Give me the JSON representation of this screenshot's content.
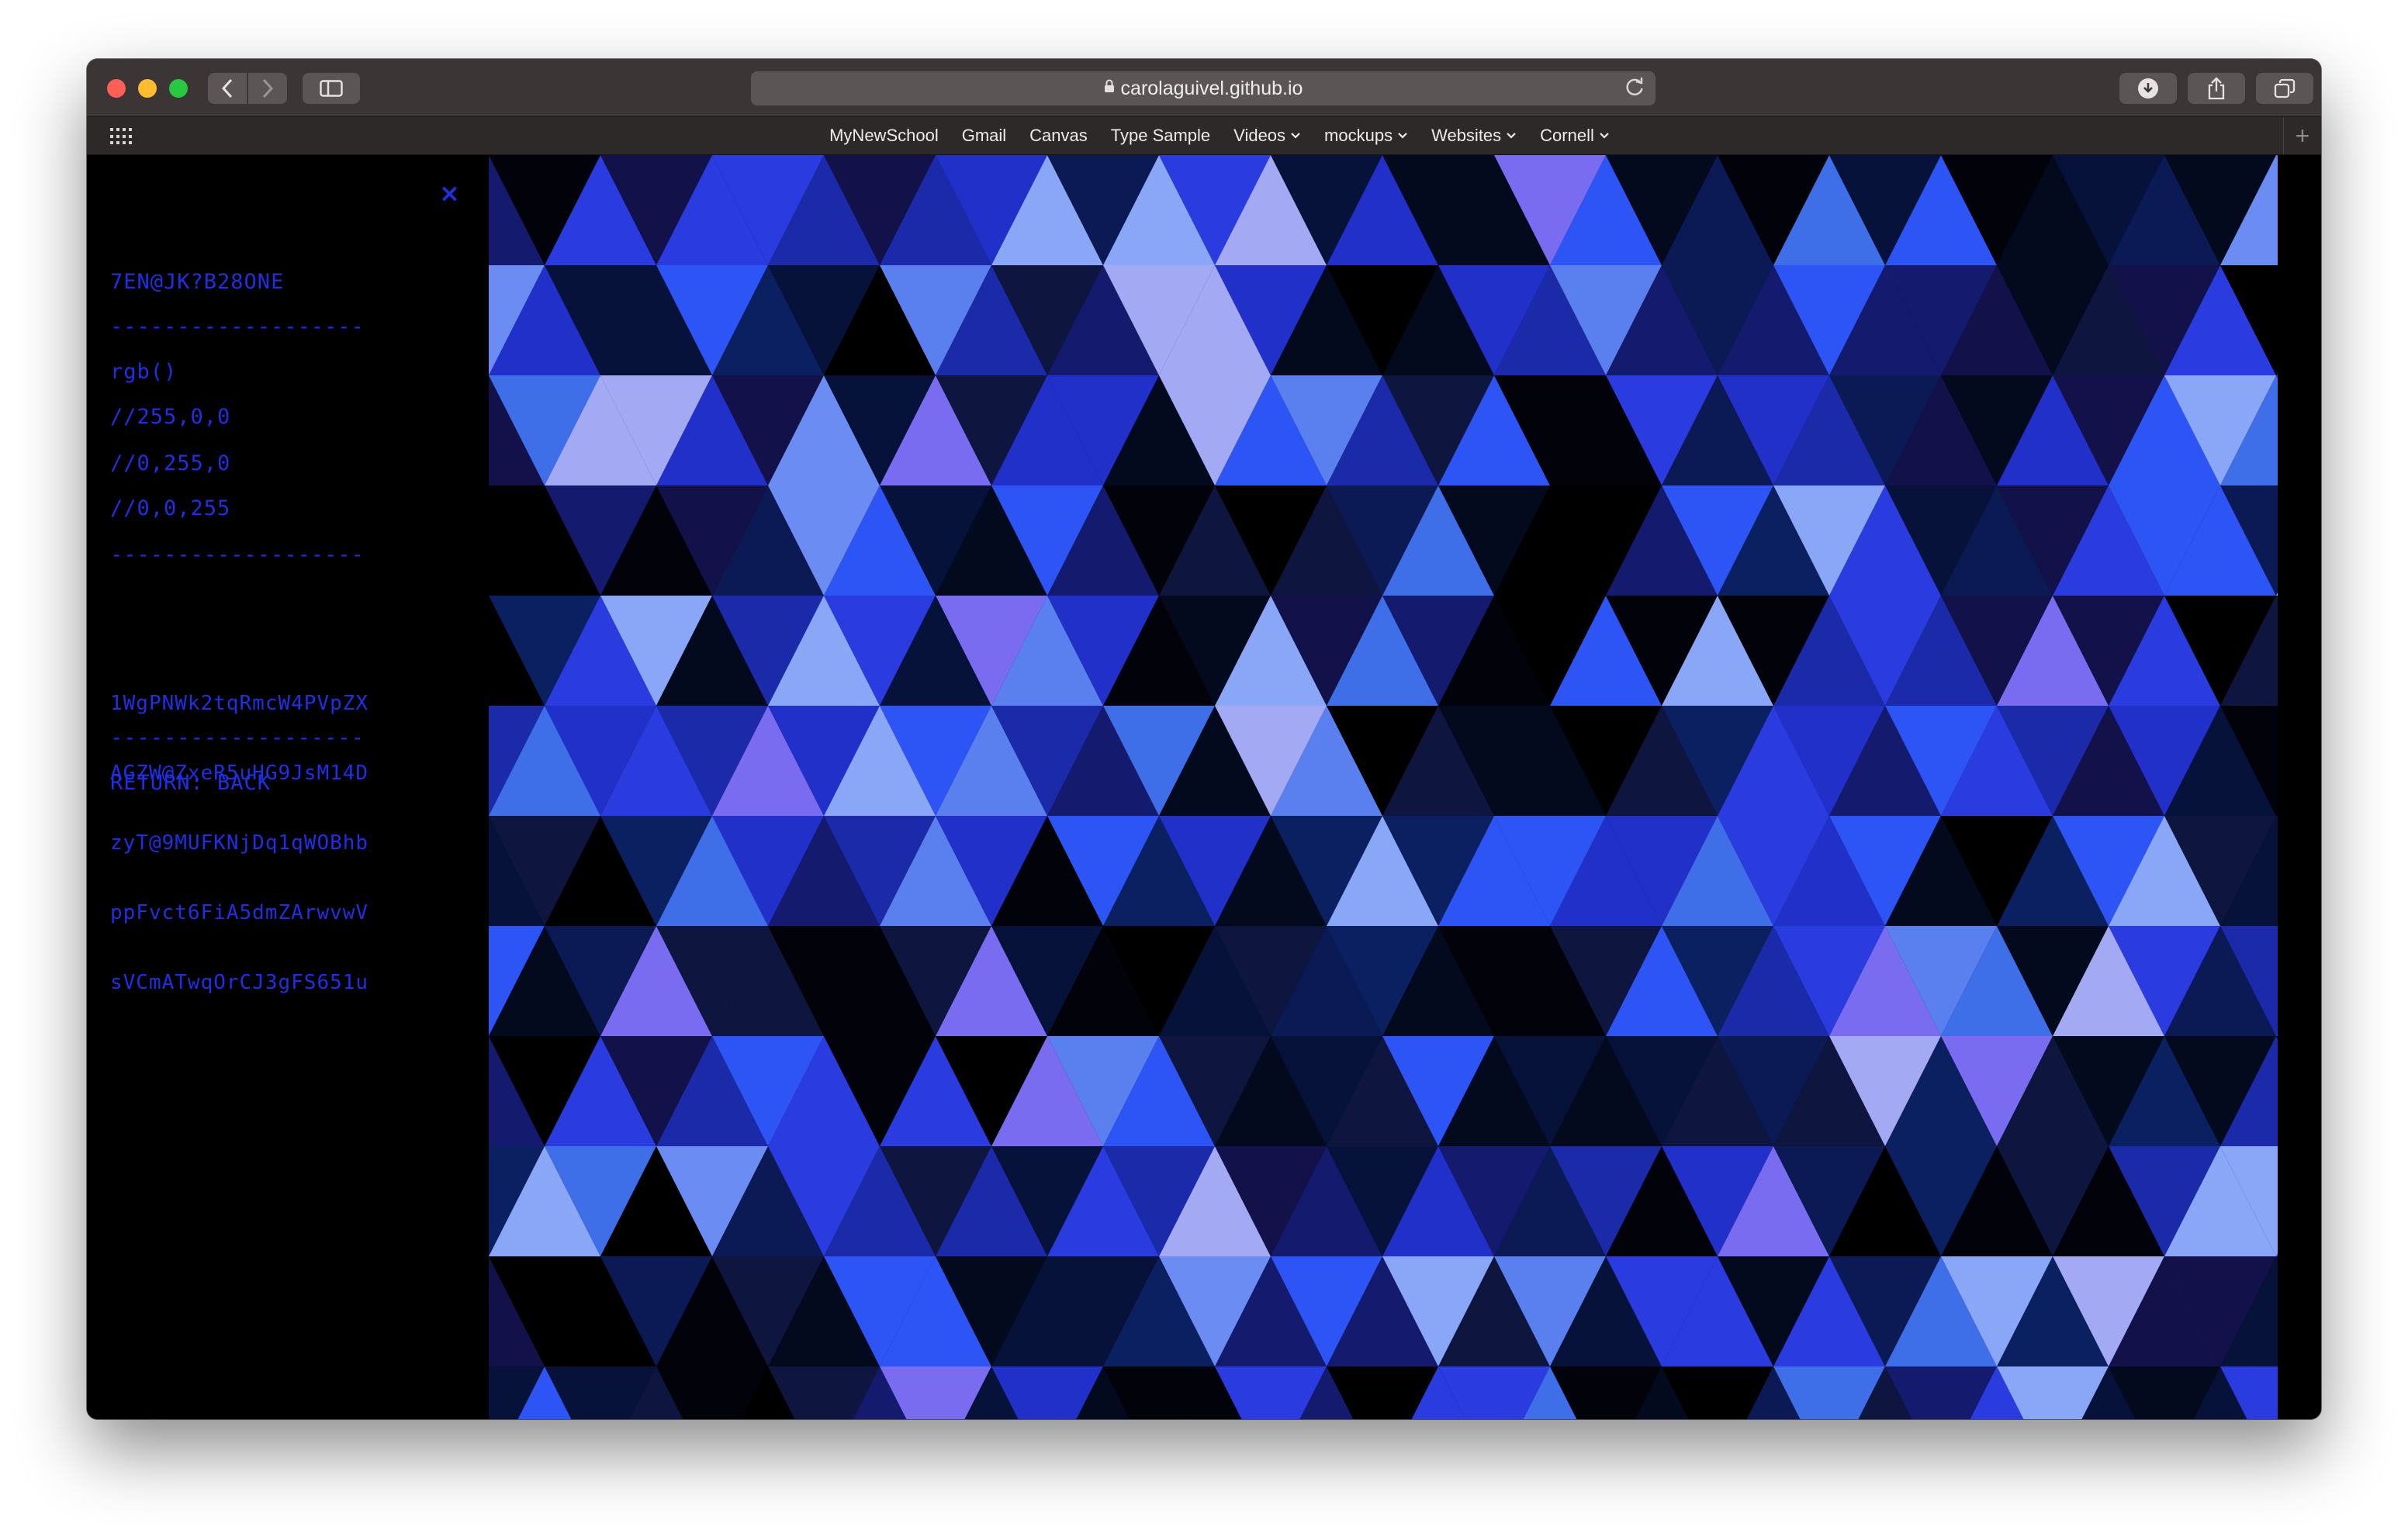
{
  "browser": {
    "url": "carolaguivel.github.io",
    "favorites": [
      {
        "label": "MyNewSchool",
        "dropdown": false
      },
      {
        "label": "Gmail",
        "dropdown": false
      },
      {
        "label": "Canvas",
        "dropdown": false
      },
      {
        "label": "Type Sample",
        "dropdown": false
      },
      {
        "label": "Videos",
        "dropdown": true
      },
      {
        "label": "mockups",
        "dropdown": true
      },
      {
        "label": "Websites",
        "dropdown": true
      },
      {
        "label": "Cornell",
        "dropdown": true
      }
    ],
    "icons": {
      "back": "chevron-left-icon",
      "forward": "chevron-right-icon",
      "sidebar": "sidebar-icon",
      "lock": "lock-icon",
      "reload": "reload-icon",
      "download": "download-icon",
      "share": "share-icon",
      "tabs": "tabs-overview-icon",
      "favorites_grid": "grid-icon",
      "new_tab": "plus-icon"
    }
  },
  "panel": {
    "close_symbol": "×",
    "code": "7EN@JK?B28ONE",
    "divider": "-------------------",
    "rgb_label": "rgb()",
    "rgb_lines": [
      "//255,0,0",
      "//0,255,0",
      "//0,0,255"
    ],
    "hash_lines": [
      "1WgPNWk2tqRmcW4PVpZX",
      "AGZW@ZxeR5uHG9JsM14D",
      "zyT@9MUFKNjDq1qWOBhb",
      "ppFvct6FiA5dmZArwvwV",
      "sVCmATwqOrCJ3gFS651u"
    ],
    "return_label": "RETURN: BACK"
  },
  "colors": {
    "panel_text": "#1d2fe8",
    "art_palette": [
      "#000000",
      "#02030a",
      "#040a1e",
      "#06123a",
      "#0b1a55",
      "#0e1640",
      "#12114a",
      "#0a2060",
      "#141a6e",
      "#1b2aa8",
      "#2030c8",
      "#2a3be0",
      "#2d55f5",
      "#3e6ee8",
      "#5a80ef",
      "#6b8cf2",
      "#7a6cf0",
      "#8aa6f7",
      "#a3a9f2"
    ]
  }
}
